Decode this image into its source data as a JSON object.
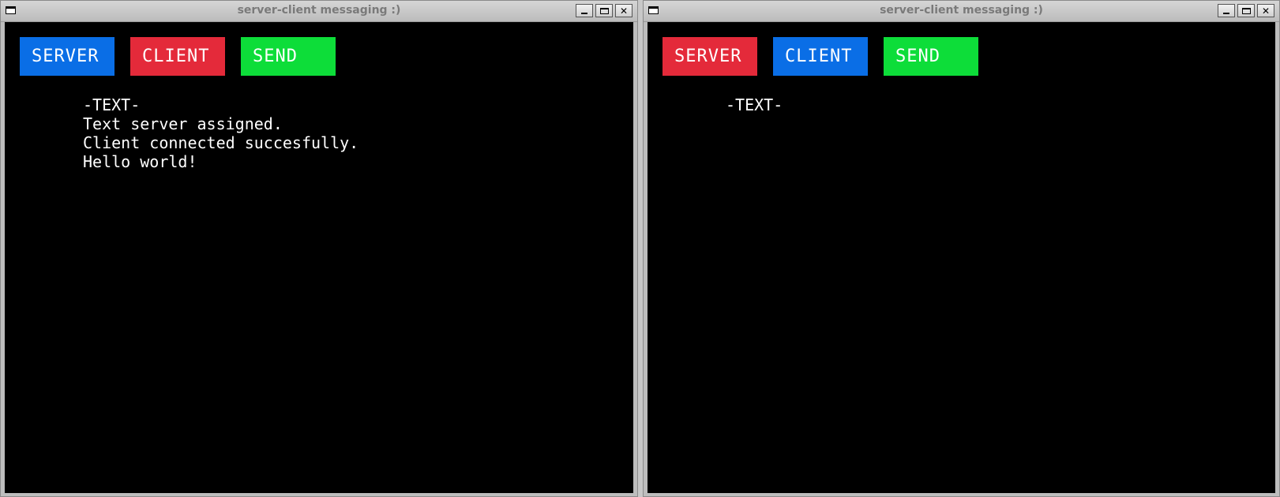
{
  "colors": {
    "blue": "#0a6ee6",
    "red": "#e42a3a",
    "green": "#0ddd39",
    "canvas": "#000000"
  },
  "windows": [
    {
      "title": "server-client messaging :)",
      "buttons": [
        {
          "label": "SERVER",
          "color": "#0a6ee6"
        },
        {
          "label": "CLIENT",
          "color": "#e42a3a"
        },
        {
          "label": "SEND",
          "color": "#0ddd39"
        }
      ],
      "log_header": "-TEXT-",
      "log_lines": [
        "Text server assigned.",
        "Client connected succesfully.",
        "Hello world!"
      ]
    },
    {
      "title": "server-client messaging :)",
      "buttons": [
        {
          "label": "SERVER",
          "color": "#e42a3a"
        },
        {
          "label": "CLIENT",
          "color": "#0a6ee6"
        },
        {
          "label": "SEND",
          "color": "#0ddd39"
        }
      ],
      "log_header": "-TEXT-",
      "log_lines": []
    }
  ],
  "window_controls": {
    "close_glyph": "✕"
  }
}
